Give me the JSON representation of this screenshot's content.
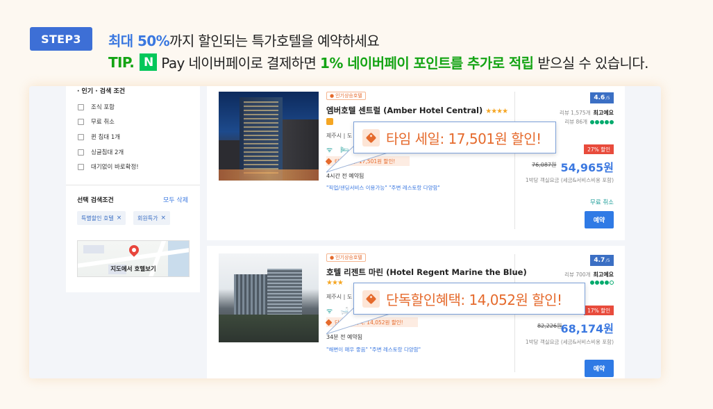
{
  "header": {
    "step": "STEP3",
    "line1_highlight": "최대 50%",
    "line1_rest": "까지 할인되는 특가호텔을 예약하세요",
    "tip": "TIP.",
    "npay_logo": "N",
    "pay_word": "Pay 네이버페이로 결제하면 ",
    "line2_highlight": "1% 네이버페이 포인트를 추가로 적립",
    "line2_rest": " 받으실 수 있습니다."
  },
  "sidebar": {
    "section_head": "· 인기 · 검색 조건",
    "filters": [
      "조식 포함",
      "무료 취소",
      "퀸 침대 1개",
      "싱글침대 2개",
      "대기없이 바로확정!"
    ],
    "selected_title": "선택 검색조건",
    "clear_all": "모두 삭제",
    "chips": [
      "특별할인 호텔",
      "회원특가"
    ],
    "chip_close": "×",
    "map_label": "지도에서 호텔보기"
  },
  "hotels": [
    {
      "badge": "인기상승호텔",
      "name": "엠버호텔 센트럴 (Amber Hotel Central)",
      "stars": "★★★★",
      "location": "제주시 | 도",
      "amenities": "ᯤ 🛏",
      "sale_line": "타임 세일: 17,501원 할인!",
      "booked": "4시간 전 예약됨",
      "review_quote": "\"픽업/샌딩서비스 이용가능\" \"주변 레스토랑 다양함\"",
      "score": "4.6",
      "score_sub": "/5",
      "reviews": "리뷰 1,575개",
      "grade": "최고예요",
      "ta_reviews": "리뷰 86개",
      "discount": "27% 할인",
      "old_price": "76,087원",
      "price": "54,965원",
      "price_note": "1박당 객실요금 (세금&서비스비용 포함)",
      "free_cancel": "무료 취소",
      "book": "예약",
      "callout": "타임 세일: 17,501원 할인!"
    },
    {
      "badge": "인기상승호텔",
      "name": "호텔 리젠트 마린 (Hotel Regent Marine the Blue)",
      "stars": "★★★",
      "location": "제주시 | 도",
      "amenities": "ᯤ 🛁",
      "sale_line": "단독할인혜택: 14,052원 할인!",
      "booked": "34분 전 예약됨",
      "review_quote": "\"해변이 매우 좋음\" \"주변 레스토랑 다양함\"",
      "score": "4.7",
      "score_sub": "/5",
      "reviews": "리뷰 700개",
      "grade": "최고예요",
      "ta_reviews": "",
      "discount": "17% 할인",
      "old_price": "82,226원",
      "price": "68,174원",
      "price_note": "1박당 객실요금 (세금&서비스비용 포함)",
      "free_cancel": "",
      "book": "예약",
      "callout": "단독할인혜택: 14,052원 할인!"
    }
  ],
  "colors": {
    "step_badge": "#3d6fd6",
    "blue_highlight": "#3b78e0",
    "green_highlight": "#14a414",
    "npay_green": "#03c75a",
    "sale_orange": "#e56a2c",
    "discount_red": "#e84b3c"
  },
  "icons": [
    "npay-logo",
    "checkbox-icon",
    "close-icon",
    "map-pin-icon",
    "fire-icon",
    "wifi-icon",
    "tag-icon",
    "tripadvisor-icon"
  ]
}
